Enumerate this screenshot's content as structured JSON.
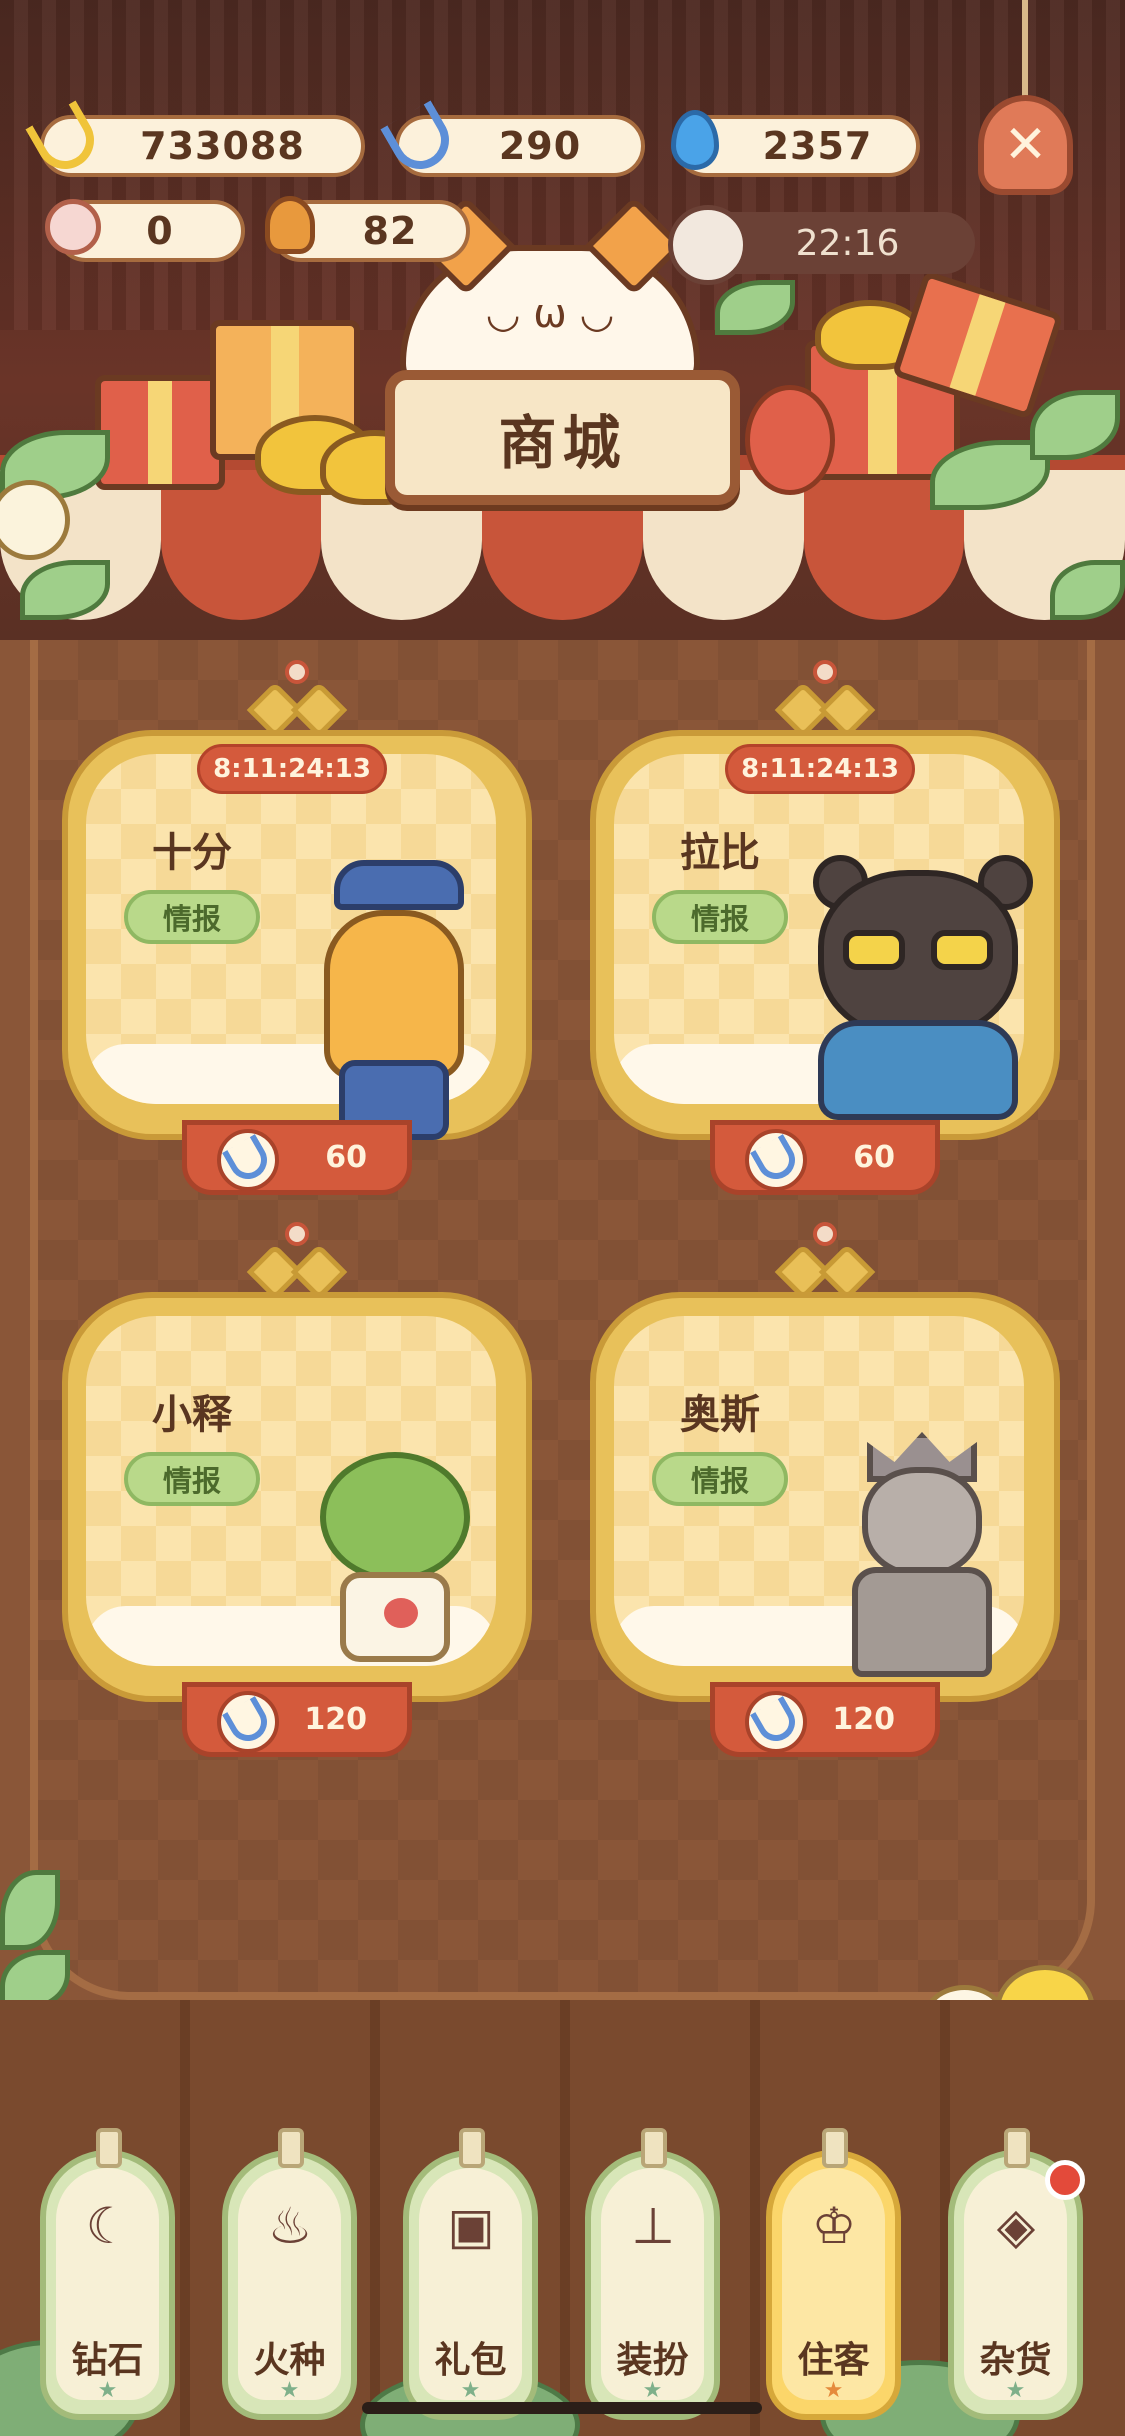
{
  "header": {
    "shop_title": "商城",
    "close_icon": "close-icon"
  },
  "currencies": {
    "gold_banana": {
      "icon": "gold-banana-icon",
      "value": "733088"
    },
    "blue_banana": {
      "icon": "blue-banana-icon",
      "value": "290"
    },
    "blue_flame": {
      "icon": "blue-flame-icon",
      "value": "2357"
    },
    "paw_item": {
      "icon": "paw-bone-icon",
      "value": "0"
    },
    "drumstick": {
      "icon": "drumstick-icon",
      "value": "82"
    },
    "event_timer": "22:16"
  },
  "cards": [
    {
      "name": "十分",
      "info_label": "情报",
      "timer": "8:11:24:13",
      "price": "60",
      "price_icon": "blue-banana-icon",
      "character": "lamp-police"
    },
    {
      "name": "拉比",
      "info_label": "情报",
      "timer": "8:11:24:13",
      "price": "60",
      "price_icon": "blue-banana-icon",
      "character": "bear-glasses"
    },
    {
      "name": "小释",
      "info_label": "情报",
      "price": "120",
      "price_icon": "blue-banana-icon",
      "character": "plant-sweater"
    },
    {
      "name": "奥斯",
      "info_label": "情报",
      "price": "120",
      "price_icon": "blue-banana-icon",
      "character": "stone-statue"
    }
  ],
  "tabs": [
    {
      "label": "钻石",
      "icon": "banana-icon",
      "active": false
    },
    {
      "label": "火种",
      "icon": "flame-icon",
      "active": false
    },
    {
      "label": "礼包",
      "icon": "gift-icon",
      "active": false
    },
    {
      "label": "装扮",
      "icon": "brush-icon",
      "active": false
    },
    {
      "label": "住客",
      "icon": "shirt-icon",
      "active": true
    },
    {
      "label": "杂货",
      "icon": "goods-icon",
      "active": false,
      "has_badge": true
    }
  ],
  "colors": {
    "panel_brown": "#8a5638",
    "card_gold": "#e8c15a",
    "price_red": "#d45a3c",
    "info_green": "#b9d98a",
    "active_tab": "#fbd66a"
  }
}
